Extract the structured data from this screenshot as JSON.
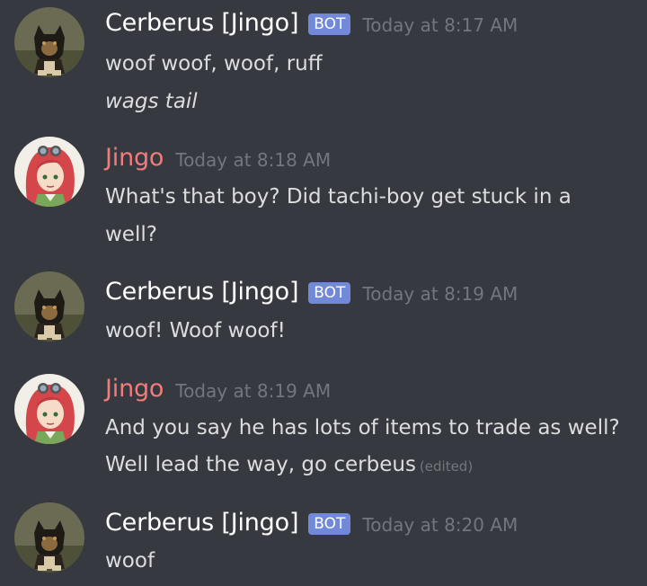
{
  "messages": [
    {
      "author": "Cerberus [Jingo]",
      "badge": "BOT",
      "timestamp": "Today at 8:17 AM",
      "avatar": "dog-avatar",
      "lines": [
        "woof woof, woof, ruff",
        "wags tail"
      ]
    },
    {
      "author": "Jingo",
      "timestamp": "Today at 8:18 AM",
      "avatar": "anime-girl-avatar",
      "lines": [
        "What's that boy? Did tachi-boy get stuck in a",
        "well?"
      ]
    },
    {
      "author": "Cerberus [Jingo]",
      "badge": "BOT",
      "timestamp": "Today at 8:19 AM",
      "avatar": "dog-avatar",
      "lines": [
        "woof! Woof woof!"
      ]
    },
    {
      "author": "Jingo",
      "timestamp": "Today at 8:19 AM",
      "avatar": "anime-girl-avatar",
      "lines": [
        "And you say he has lots of items to trade as well?",
        "Well lead the way, go cerbeus"
      ],
      "edited": "(edited)"
    },
    {
      "author": "Cerberus [Jingo]",
      "badge": "BOT",
      "timestamp": "Today at 8:20 AM",
      "avatar": "dog-avatar",
      "lines": [
        "woof"
      ]
    }
  ],
  "colors": {
    "background": "#36393f",
    "bot_badge": "#7289da",
    "jingo_name": "#f47b7b",
    "timestamp": "#72767d",
    "text": "#dcddde"
  }
}
